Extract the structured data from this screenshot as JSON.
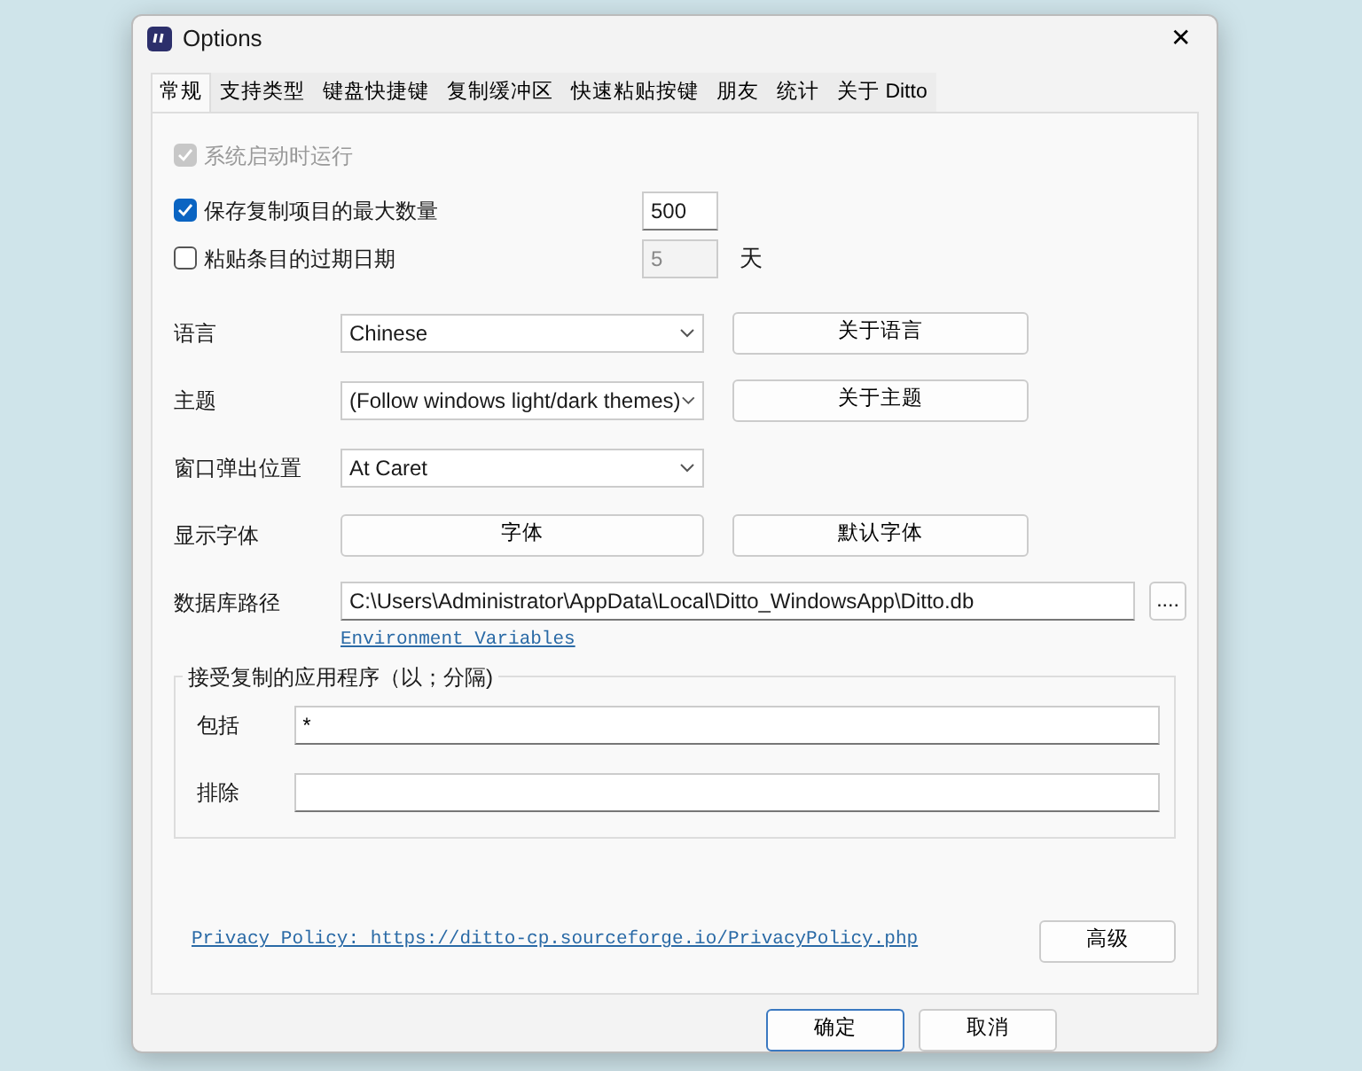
{
  "window": {
    "title": "Options",
    "close": "✕"
  },
  "tabs": [
    {
      "label": "常规",
      "selected": true
    },
    {
      "label": "支持类型",
      "selected": false
    },
    {
      "label": "键盘快捷键",
      "selected": false
    },
    {
      "label": "复制缓冲区",
      "selected": false
    },
    {
      "label": "快速粘贴按键",
      "selected": false
    },
    {
      "label": "朋友",
      "selected": false
    },
    {
      "label": "统计",
      "selected": false
    },
    {
      "label": "关于 Ditto",
      "selected": false
    }
  ],
  "checks": [
    {
      "label": "系统启动时运行",
      "checked": true,
      "disabled": true
    },
    {
      "label": "保存复制项目的最大数量",
      "checked": true,
      "disabled": false,
      "field": {
        "value": "500",
        "disabled": false
      }
    },
    {
      "label": "粘贴条目的过期日期",
      "checked": false,
      "disabled": false,
      "field": {
        "value": "5",
        "disabled": true
      },
      "unit": "天"
    }
  ],
  "settings": [
    {
      "kind": "select",
      "label": "语言",
      "value": "Chinese",
      "button": "关于语言"
    },
    {
      "kind": "select",
      "label": "主题",
      "value": "(Follow windows light/dark themes)",
      "button": "关于主题"
    },
    {
      "kind": "select",
      "label": "窗口弹出位置",
      "value": "At Caret"
    },
    {
      "kind": "buttons",
      "label": "显示字体",
      "button": "字体",
      "button2": "默认字体"
    },
    {
      "kind": "path",
      "label": "数据库路径",
      "value": "C:\\Users\\Administrator\\AppData\\Local\\Ditto_WindowsApp\\Ditto.db",
      "button": "....",
      "link": "Environment Variables"
    }
  ],
  "apps_group": {
    "title": "接受复制的应用程序（以；分隔)",
    "fields": [
      {
        "label": "包括",
        "value": "*"
      },
      {
        "label": "排除"
      }
    ]
  },
  "privacy_link": "Privacy Policy: https://ditto-cp.sourceforge.io/PrivacyPolicy.php",
  "advanced_button": "高级",
  "footer_buttons": [
    {
      "label": "确定",
      "default": true
    },
    {
      "label": "取消",
      "default": false
    }
  ]
}
